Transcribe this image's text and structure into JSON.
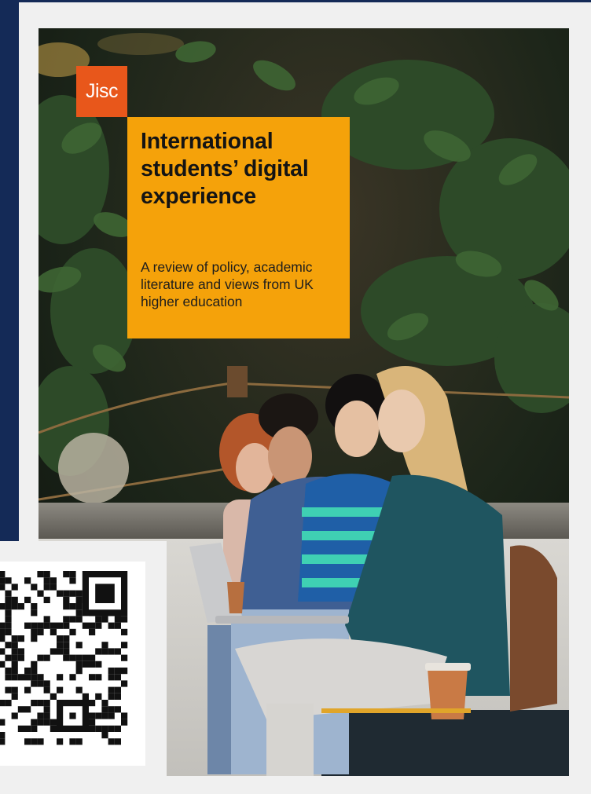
{
  "cover": {
    "logo_text": "Jisc",
    "title": "International students’ digital experience",
    "subtitle": "A review of policy, academic literature and views from UK higher education",
    "colors": {
      "title_box": "#f5a20a",
      "logo": "#e8571b",
      "backdrop": "#142a57"
    }
  },
  "photo": {
    "icon": "students-on-bench-photo"
  },
  "qr": {
    "icon": "qr-code-icon"
  }
}
